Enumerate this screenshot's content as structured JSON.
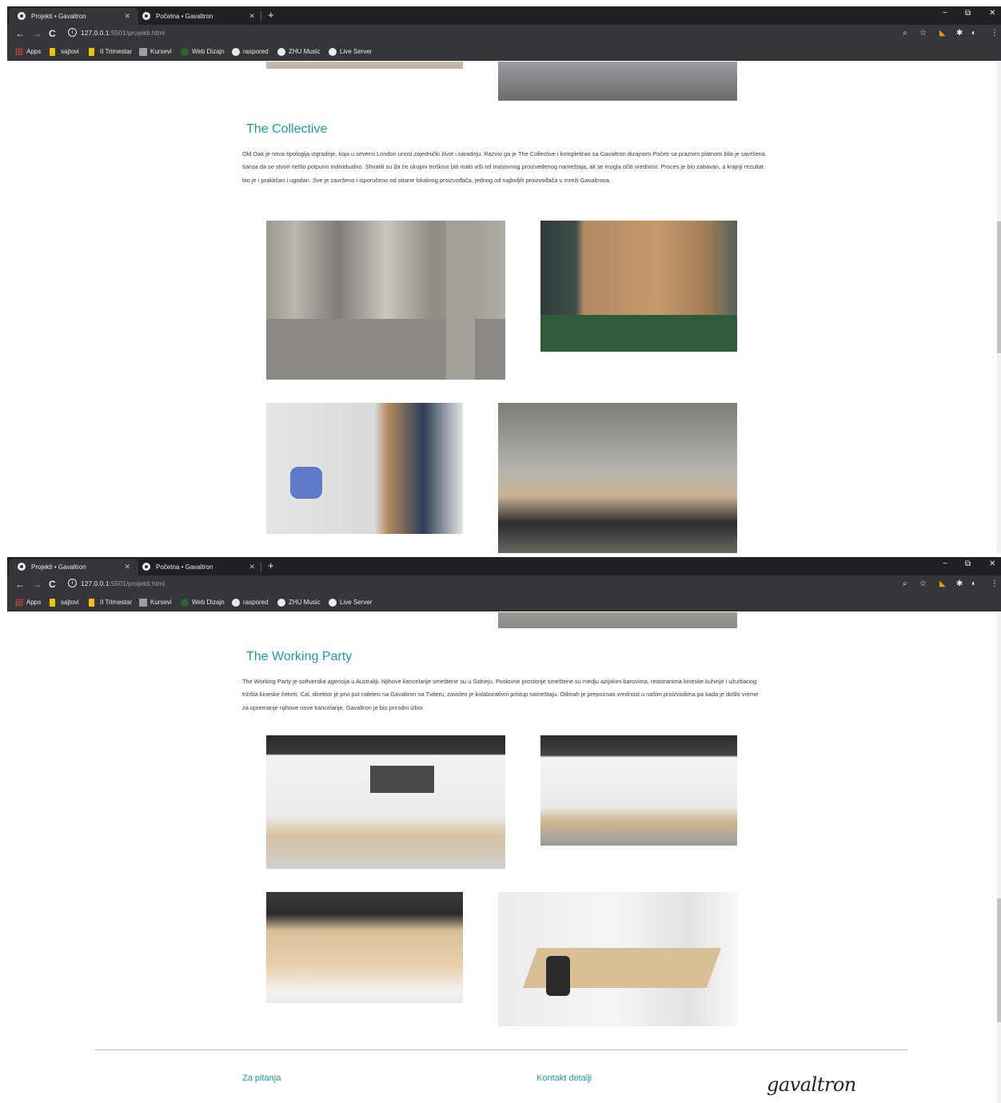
{
  "browser": {
    "tabs": [
      {
        "title": "Projekti • Gavaltron",
        "active": true
      },
      {
        "title": "Početna • Gavaltron",
        "active": false
      }
    ],
    "new_tab": "+",
    "close_tab": "✕",
    "window_controls": {
      "minimize": "−",
      "maximize": "⧉",
      "close": "✕"
    },
    "nav": {
      "back": "←",
      "forward": "→",
      "reload": "C"
    },
    "url_host": "127.0.0.1",
    "url_rest": ":5501/projekti.html",
    "bookmarks": [
      {
        "label": "Apps",
        "icon": "apps-icon"
      },
      {
        "label": "sajtovi",
        "icon": "folder-icon"
      },
      {
        "label": "II Trimestar",
        "icon": "folder-icon"
      },
      {
        "label": "Kursevi",
        "icon": "book-icon"
      },
      {
        "label": "Web Dizajn",
        "icon": "web-icon"
      },
      {
        "label": "raspored",
        "icon": "globe-icon"
      },
      {
        "label": "ZHU Music",
        "icon": "globe-icon"
      },
      {
        "label": "Live Server",
        "icon": "globe-icon"
      }
    ]
  },
  "collective": {
    "title": "The Collective",
    "text": "Old Oak je nova tipologija izgradnje, koja u severni London unosi zajednički život i saradnju. Razvio ga je The Collective i kompletirao sa Gavaltron dizajnom.Početi sa praznim platnom bila je savršena šansa da se stvori nešto potpuno individualno. Shvatili su da će ukupni troškovi biti malo viši od masovnog proizvedenog nameštaja, ali se mogla očiti vrednost. Proces je bio zabavan, a krajnji rezultat bio je i praktičan i ugodan. Sve je završeno i isporučeno od strane lokalnog proizvođača, jednog od najboljih proizvođača u mreži Gavaltrona."
  },
  "working_party": {
    "title": "The Working Party",
    "text": "The Working Party je softverska agencija u Australiji. Njihove kancelarije smeštene su u Sidneju. Poslovne prostorije smeštene su medju azijskim barovima, restoranima kineske kuhinje i užurbanog tržišta kineske četvrti. Cal, direktor je prvi put naleteo na Gavaltron na Tviteru, zavoleo je kolaborativni pristup nameštaju. Odmah je prepoznao vrednost u našim proizvodima pa kada je došlo vreme za opremanje njihove nove kancelarije, Gavaltron je bio prirodni izbor."
  },
  "footer": {
    "questions_heading": "Za pitanja",
    "contact_heading": "Kontakt detalji",
    "brand": "gavaltron"
  },
  "colors": {
    "accent": "#1a9fa8",
    "chrome_dark": "#202124",
    "chrome": "#35363a"
  }
}
